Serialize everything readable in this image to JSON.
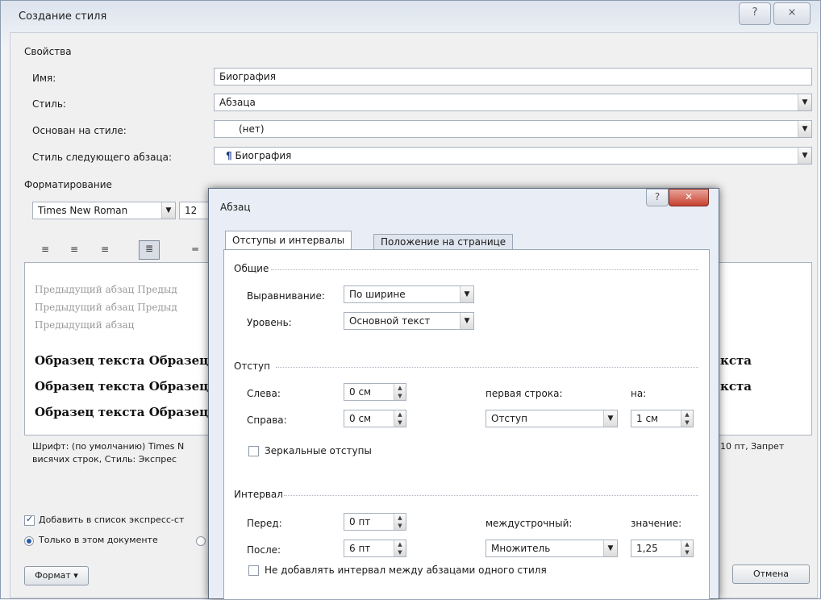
{
  "window": {
    "title": "Создание стиля",
    "help_glyph": "?",
    "close_glyph": "⨯"
  },
  "properties": {
    "group_label": "Свойства",
    "name_label": "Имя:",
    "name_value": "Биография",
    "style_label": "Стиль:",
    "style_value": "Абзаца",
    "based_on_label": "Основан на стиле:",
    "based_on_value": "(нет)",
    "next_style_label": "Стиль следующего абзаца:",
    "next_style_value": "Биография",
    "next_style_mark": "¶"
  },
  "formatting": {
    "group_label": "Форматирование",
    "font_value": "Times New Roman",
    "size_value": "12",
    "align_icons": [
      "align-left-icon",
      "align-center-icon",
      "align-right-icon",
      "align-justify-icon"
    ]
  },
  "preview": {
    "prev_lines": [
      "Предыдущий абзац Предыд",
      "Предыдущий абзац Предыд",
      "Предыдущий абзац"
    ],
    "sample_lines": [
      "Образец текста Образец",
      "Образец текста Образец",
      "Образец текста Образец"
    ],
    "sample_right": [
      "кста",
      "кста"
    ]
  },
  "description": {
    "line1_left": "Шрифт: (по умолчанию) Times N",
    "line1_right": "10 пт, Запрет",
    "line2_left": "висячих строк, Стиль: Экспрес"
  },
  "options": {
    "add_to_gallery": "Добавить в список экспресс-ст",
    "only_this_doc": "Только в этом документе"
  },
  "buttons": {
    "format": "Формат ▾",
    "cancel": "Отмена"
  },
  "paragraph_dialog": {
    "title": "Абзац",
    "tabs": [
      "Отступы и интервалы",
      "Положение на странице"
    ],
    "general": {
      "header": "Общие",
      "alignment_label": "Выравнивание:",
      "alignment_value": "По ширине",
      "level_label": "Уровень:",
      "level_value": "Основной текст"
    },
    "indent": {
      "header": "Отступ",
      "left_label": "Слева:",
      "left_value": "0 см",
      "right_label": "Справа:",
      "right_value": "0 см",
      "first_line_label": "первая строка:",
      "first_line_value": "Отступ",
      "by_label": "на:",
      "by_value": "1 см",
      "mirror_label": "Зеркальные отступы"
    },
    "spacing": {
      "header": "Интервал",
      "before_label": "Перед:",
      "before_value": "0 пт",
      "after_label": "После:",
      "after_value": "6 пт",
      "line_label": "междустрочный:",
      "line_value": "Множитель",
      "at_label": "значение:",
      "at_value": "1,25",
      "no_space_label": "Не добавлять интервал между абзацами одного стиля"
    }
  }
}
